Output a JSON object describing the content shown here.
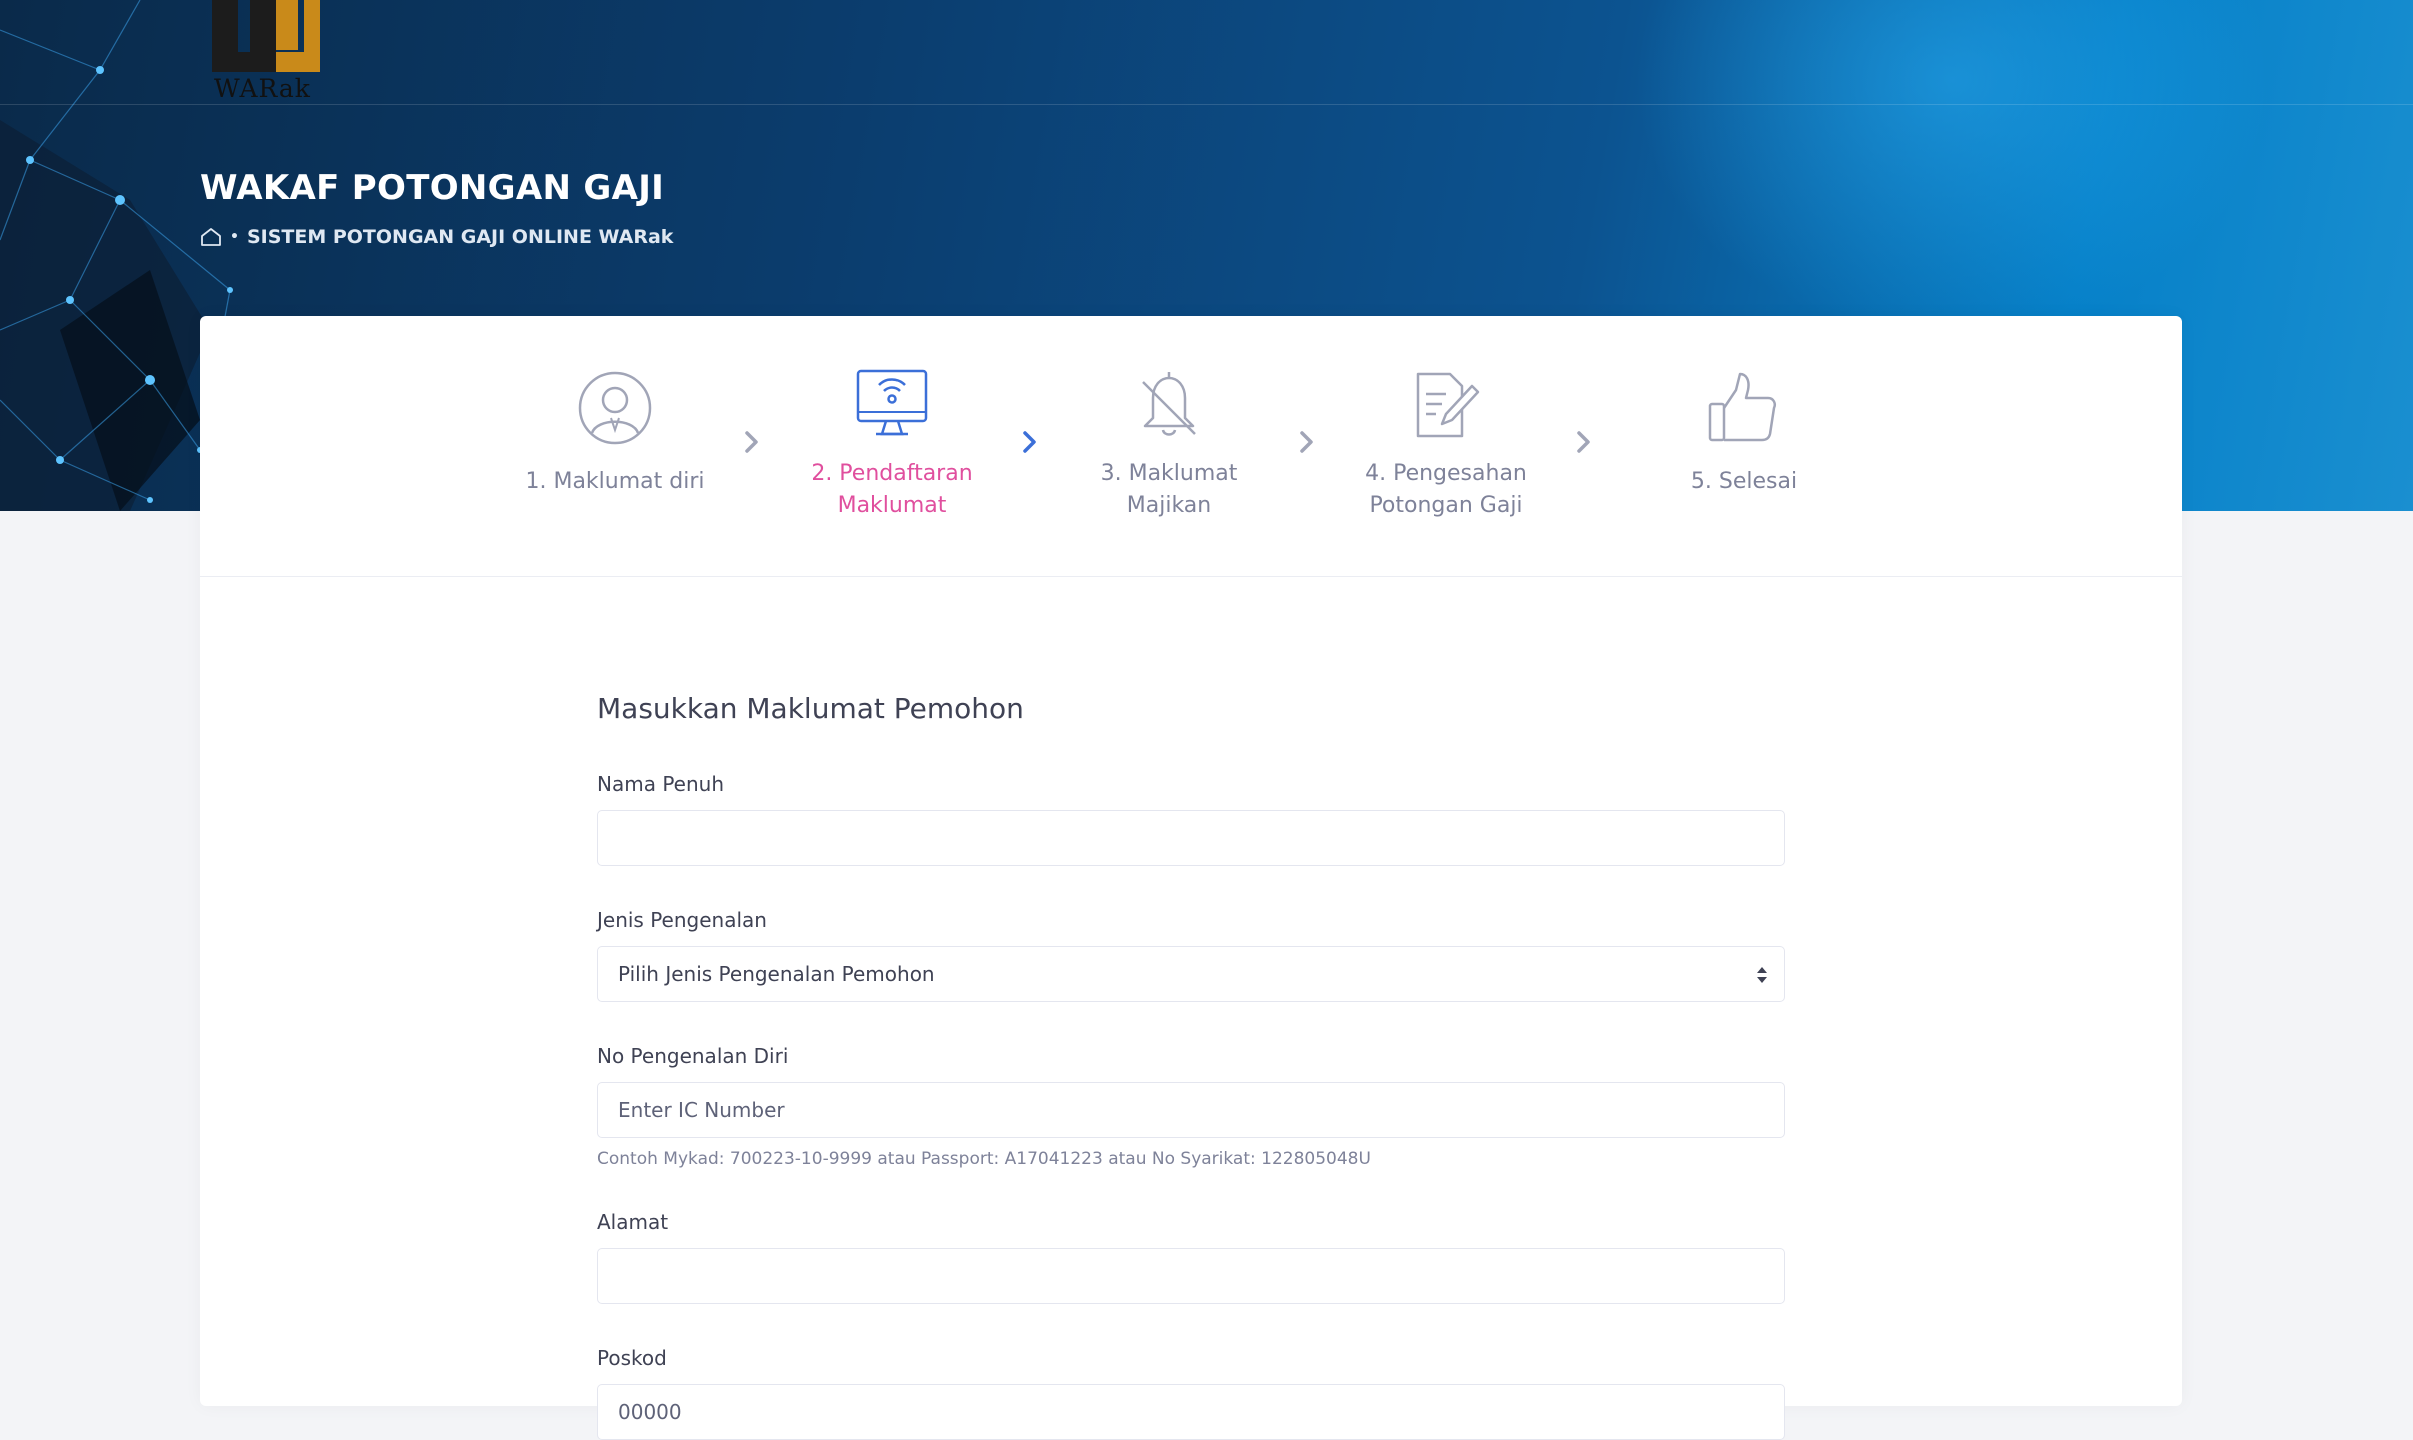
{
  "logo": {
    "text": "WARak"
  },
  "header": {
    "title": "WAKAF POTONGAN GAJI",
    "breadcrumb": "SISTEM POTONGAN GAJI ONLINE WARak"
  },
  "steps": [
    {
      "label": "1. Maklumat diri",
      "icon": "user-icon",
      "active": false
    },
    {
      "label": "2. Pendaftaran Maklumat",
      "icon": "monitor-wifi-icon",
      "active": true
    },
    {
      "label": "3. Maklumat Majikan",
      "icon": "bell-off-icon",
      "active": false
    },
    {
      "label": "4. Pengesahan Potongan Gaji",
      "icon": "document-edit-icon",
      "active": false
    },
    {
      "label": "5. Selesai",
      "icon": "thumbs-up-icon",
      "active": false
    }
  ],
  "form": {
    "title": "Masukkan Maklumat Pemohon",
    "nama": {
      "label": "Nama Penuh",
      "value": ""
    },
    "jenis": {
      "label": "Jenis Pengenalan",
      "selected": "Pilih Jenis Pengenalan Pemohon"
    },
    "ic": {
      "label": "No Pengenalan Diri",
      "placeholder": "Enter IC Number",
      "hint": "Contoh Mykad: 700223-10-9999 atau Passport: A17041223 atau No Syarikat: 122805048U"
    },
    "alamat": {
      "label": "Alamat",
      "value": ""
    },
    "poskod": {
      "label": "Poskod",
      "placeholder": "00000"
    }
  },
  "colors": {
    "active_step": "#e04f9e",
    "active_arrow": "#3b6fd8",
    "header_dark": "#0a2a4a",
    "header_light": "#0680c8"
  }
}
